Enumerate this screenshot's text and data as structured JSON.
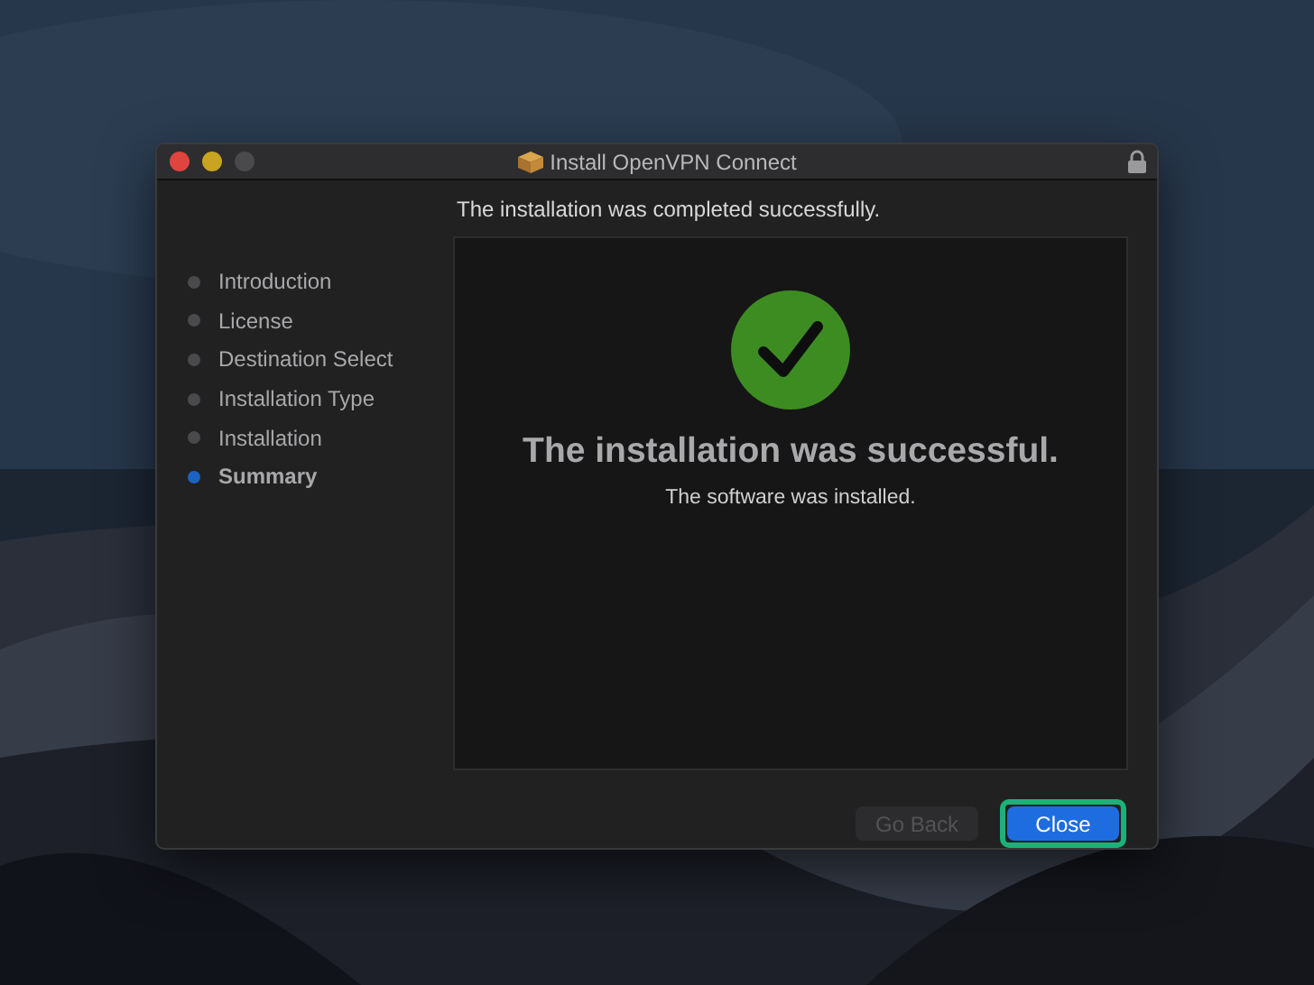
{
  "window": {
    "title": "Install OpenVPN Connect"
  },
  "header": "The installation was completed successfully.",
  "steps": [
    {
      "label": "Introduction",
      "selected": false
    },
    {
      "label": "License",
      "selected": false
    },
    {
      "label": "Destination Select",
      "selected": false
    },
    {
      "label": "Installation Type",
      "selected": false
    },
    {
      "label": "Installation",
      "selected": false
    },
    {
      "label": "Summary",
      "selected": true
    }
  ],
  "result": {
    "heading": "The installation was successful.",
    "message": "The software was installed."
  },
  "buttons": [
    {
      "label": "Go Back",
      "disabled": true,
      "primary": false,
      "highlighted": false
    },
    {
      "label": "Close",
      "disabled": false,
      "primary": true,
      "highlighted": true
    }
  ]
}
